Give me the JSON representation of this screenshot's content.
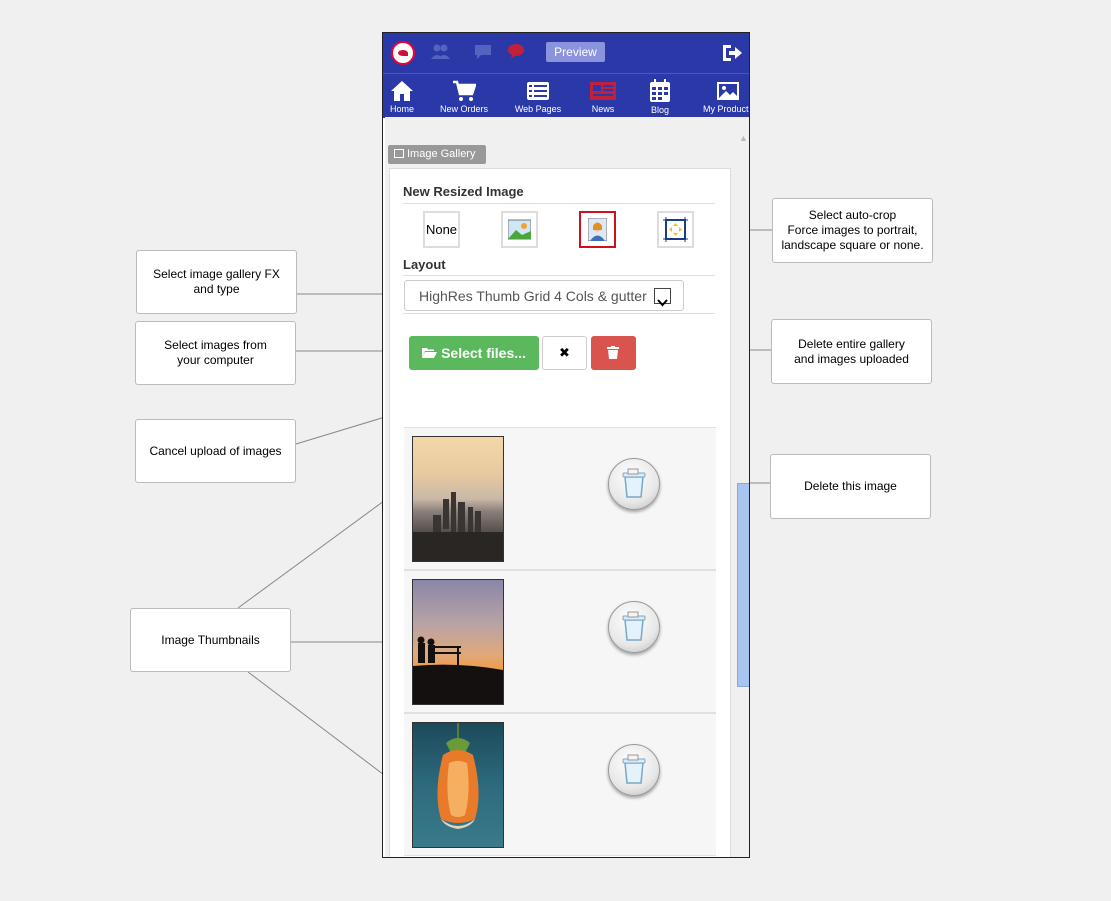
{
  "topbar": {
    "preview_label": "Preview"
  },
  "nav": {
    "items": [
      {
        "label": "Home",
        "icon": "home-icon"
      },
      {
        "label": "New Orders",
        "icon": "cart-icon"
      },
      {
        "label": "Web Pages",
        "icon": "list-icon"
      },
      {
        "label": "News",
        "icon": "newspaper-icon"
      },
      {
        "label": "Blog",
        "icon": "calendar-icon"
      },
      {
        "label": "My Products",
        "icon": "picture-icon"
      }
    ]
  },
  "panel": {
    "tag_label": "Image Gallery",
    "resize_heading": "New Resized Image",
    "crop_options": [
      "None",
      "landscape",
      "portrait",
      "square"
    ],
    "crop_selected": "portrait",
    "layout_heading": "Layout",
    "layout_value": "HighRes Thumb Grid 4 Cols & gutter",
    "select_files_label": "Select files...",
    "cancel_label": "✖"
  },
  "thumbnails": [
    {
      "subject": "city skyline at sunset"
    },
    {
      "subject": "couple on bench at sunset"
    },
    {
      "subject": "orange bell flower"
    }
  ],
  "callouts": {
    "autocrop": "Select auto-crop\nForce images to  portrait,\nlandscape square or none.",
    "gallery_fx": "Select image gallery FX\nand type",
    "select_images": "Select images from\nyour computer",
    "delete_gallery": "Delete entire gallery\nand images uploaded",
    "cancel_upload": "Cancel upload of images",
    "delete_image": "Delete this image",
    "thumbnails": "Image Thumbnails"
  },
  "colors": {
    "brand_blue": "#2b38a8",
    "success_green": "#5cb85c",
    "danger_red": "#d9534f",
    "selected_border": "#d0101e"
  }
}
